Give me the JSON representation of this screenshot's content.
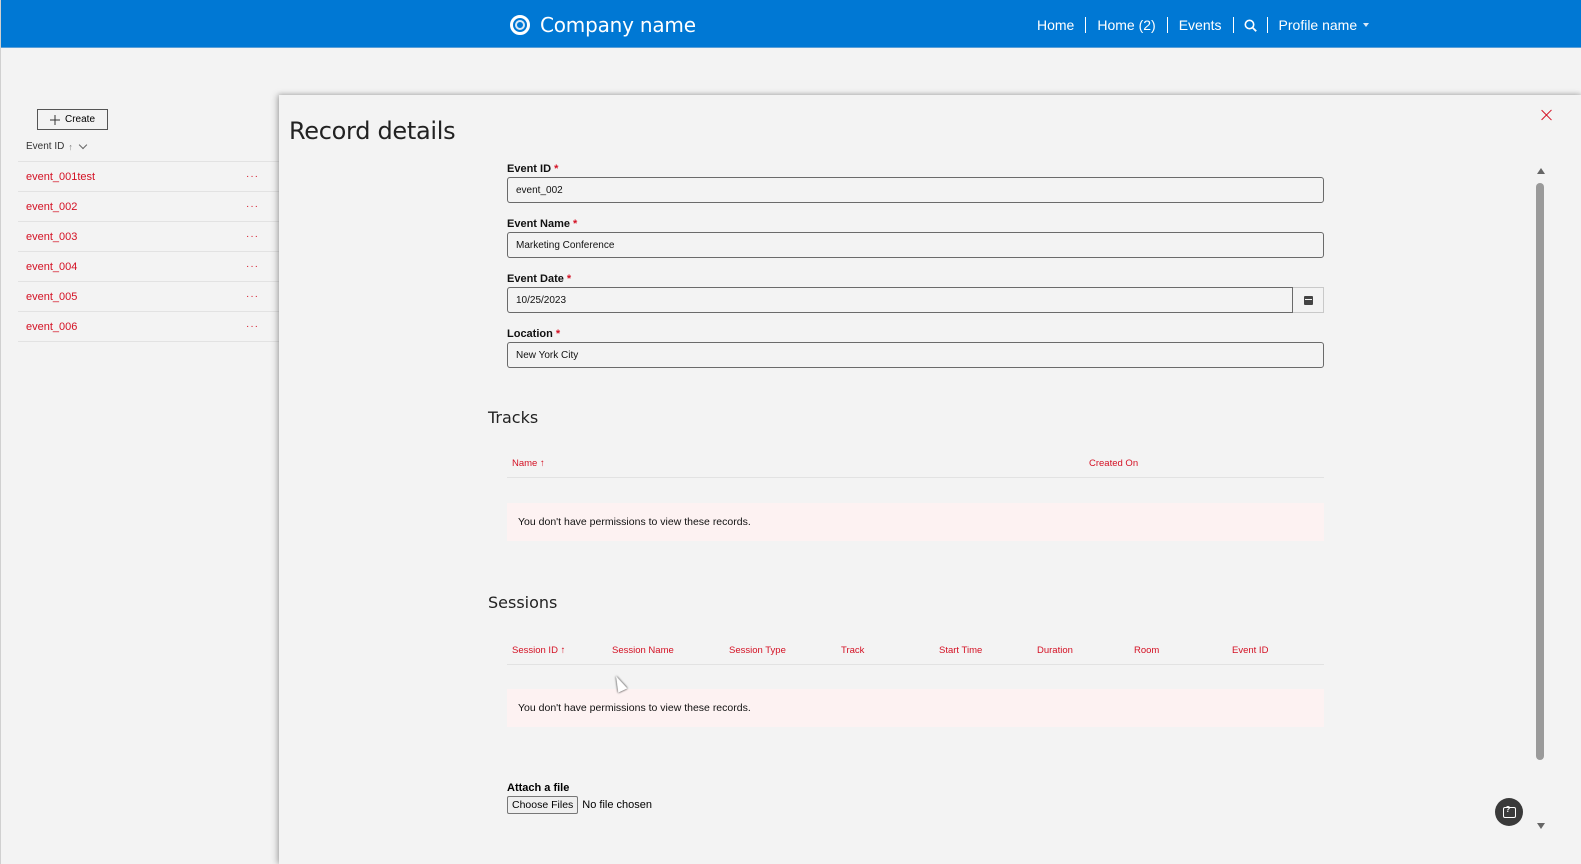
{
  "header": {
    "company_name": "Company name",
    "nav": [
      "Home",
      "Home (2)",
      "Events"
    ],
    "profile_label": "Profile name"
  },
  "list": {
    "create_label": "Create",
    "column_header": "Event ID",
    "sort_indicator": "↑",
    "rows": [
      "event_001test",
      "event_002",
      "event_003",
      "event_004",
      "event_005",
      "event_006"
    ],
    "row_menu": "···"
  },
  "modal": {
    "title": "Record details",
    "fields": {
      "event_id": {
        "label": "Event ID",
        "value": "event_002"
      },
      "event_name": {
        "label": "Event Name",
        "value": "Marketing Conference"
      },
      "event_date": {
        "label": "Event Date",
        "value": "10/25/2023"
      },
      "location": {
        "label": "Location",
        "value": "New York City"
      }
    },
    "required_marker": "*",
    "tracks": {
      "title": "Tracks",
      "columns": [
        "Name ↑",
        "Created On"
      ],
      "message": "You don't have permissions to view these records."
    },
    "sessions": {
      "title": "Sessions",
      "columns": [
        "Session ID ↑",
        "Session Name",
        "Session Type",
        "Track",
        "Start Time",
        "Duration",
        "Room",
        "Event ID"
      ],
      "message": "You don't have permissions to view these records."
    },
    "attach": {
      "label": "Attach a file",
      "button": "Choose Files",
      "status": "No file chosen"
    }
  },
  "colors": {
    "header_blue": "#0078d4",
    "link_red": "#d41124"
  }
}
